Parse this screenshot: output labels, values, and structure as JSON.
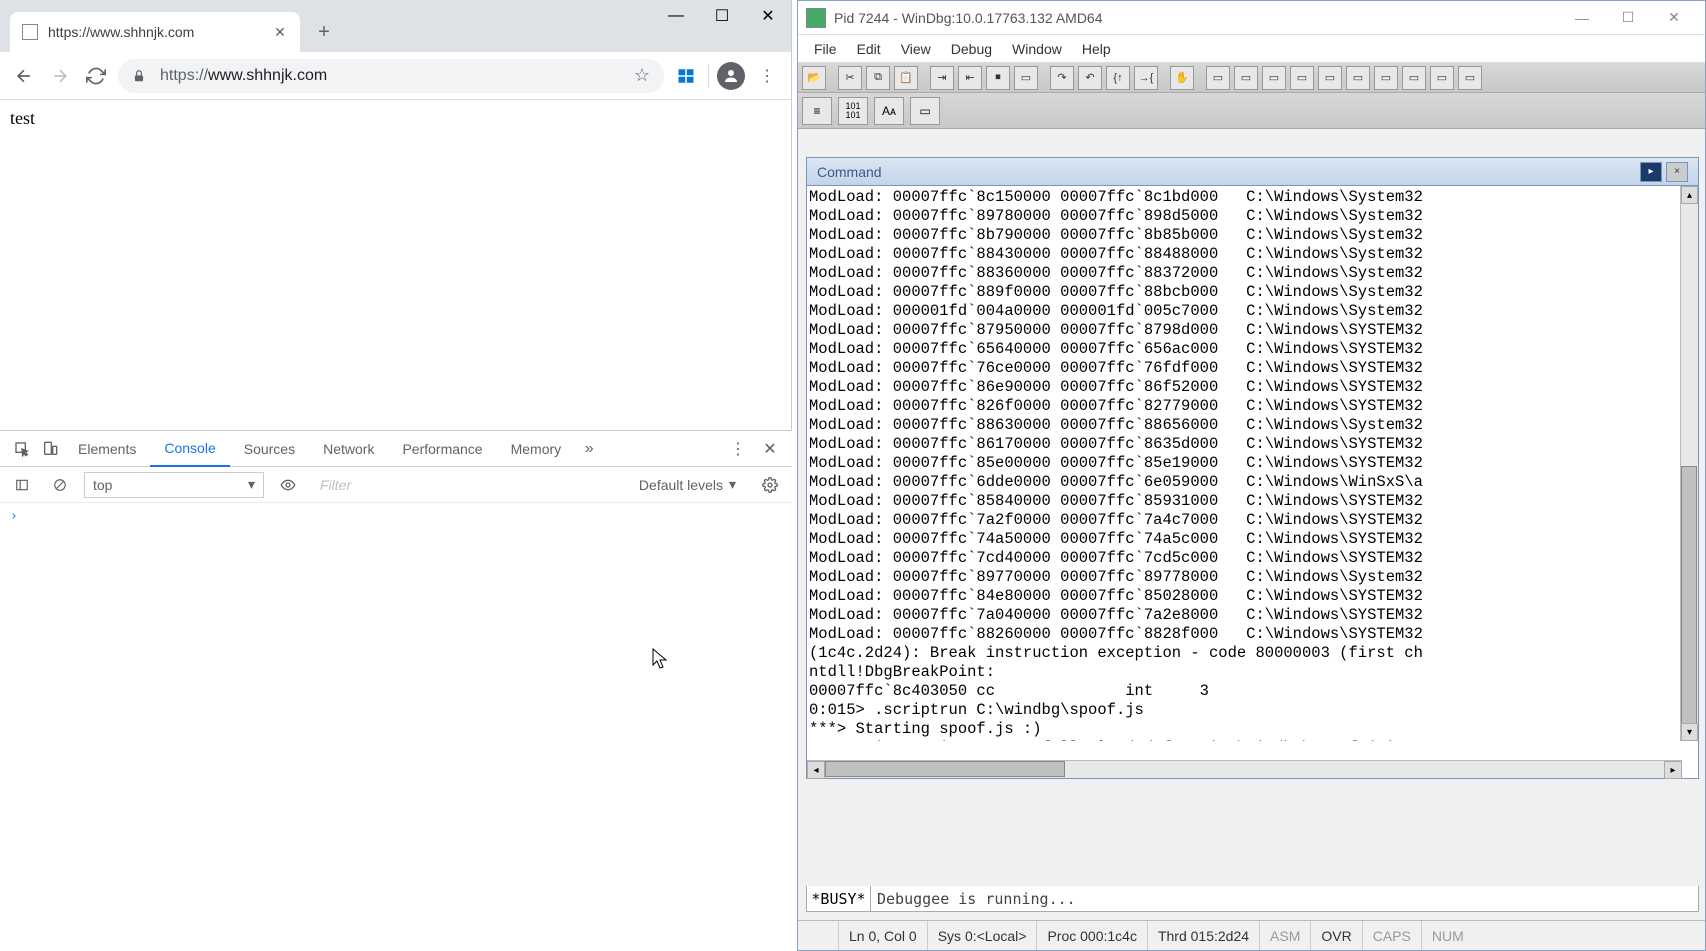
{
  "chrome": {
    "tab": {
      "title": "https://www.shhnjk.com"
    },
    "url_scheme": "https://",
    "url_rest": "www.shhnjk.com",
    "page_text": "test"
  },
  "devtools": {
    "tabs": [
      "Elements",
      "Console",
      "Sources",
      "Network",
      "Performance",
      "Memory"
    ],
    "active_tab": "Console",
    "context": "top",
    "filter_placeholder": "Filter",
    "levels": "Default levels"
  },
  "windbg": {
    "title": "Pid 7244 - WinDbg:10.0.17763.132 AMD64",
    "menus": [
      "File",
      "Edit",
      "View",
      "Debug",
      "Window",
      "Help"
    ],
    "command_title": "Command",
    "output": [
      "ModLoad: 00007ffc`8c150000 00007ffc`8c1bd000   C:\\Windows\\System32",
      "ModLoad: 00007ffc`89780000 00007ffc`898d5000   C:\\Windows\\System32",
      "ModLoad: 00007ffc`8b790000 00007ffc`8b85b000   C:\\Windows\\System32",
      "ModLoad: 00007ffc`88430000 00007ffc`88488000   C:\\Windows\\System32",
      "ModLoad: 00007ffc`88360000 00007ffc`88372000   C:\\Windows\\System32",
      "ModLoad: 00007ffc`889f0000 00007ffc`88bcb000   C:\\Windows\\System32",
      "ModLoad: 000001fd`004a0000 000001fd`005c7000   C:\\Windows\\System32",
      "ModLoad: 00007ffc`87950000 00007ffc`8798d000   C:\\Windows\\SYSTEM32",
      "ModLoad: 00007ffc`65640000 00007ffc`656ac000   C:\\Windows\\SYSTEM32",
      "ModLoad: 00007ffc`76ce0000 00007ffc`76fdf000   C:\\Windows\\SYSTEM32",
      "ModLoad: 00007ffc`86e90000 00007ffc`86f52000   C:\\Windows\\SYSTEM32",
      "ModLoad: 00007ffc`826f0000 00007ffc`82779000   C:\\Windows\\SYSTEM32",
      "ModLoad: 00007ffc`88630000 00007ffc`88656000   C:\\Windows\\System32",
      "ModLoad: 00007ffc`86170000 00007ffc`8635d000   C:\\Windows\\SYSTEM32",
      "ModLoad: 00007ffc`85e00000 00007ffc`85e19000   C:\\Windows\\SYSTEM32",
      "ModLoad: 00007ffc`6dde0000 00007ffc`6e059000   C:\\Windows\\WinSxS\\a",
      "ModLoad: 00007ffc`85840000 00007ffc`85931000   C:\\Windows\\SYSTEM32",
      "ModLoad: 00007ffc`7a2f0000 00007ffc`7a4c7000   C:\\Windows\\SYSTEM32",
      "ModLoad: 00007ffc`74a50000 00007ffc`74a5c000   C:\\Windows\\SYSTEM32",
      "ModLoad: 00007ffc`7cd40000 00007ffc`7cd5c000   C:\\Windows\\SYSTEM32",
      "ModLoad: 00007ffc`89770000 00007ffc`89778000   C:\\Windows\\System32",
      "ModLoad: 00007ffc`84e80000 00007ffc`85028000   C:\\Windows\\SYSTEM32",
      "ModLoad: 00007ffc`7a040000 00007ffc`7a2e8000   C:\\Windows\\SYSTEM32",
      "ModLoad: 00007ffc`88260000 00007ffc`8828f000   C:\\Windows\\SYSTEM32",
      "(1c4c.2d24): Break instruction exception - code 80000003 (first ch",
      "ntdll!DbgBreakPoint:",
      "00007ffc`8c403050 cc              int     3",
      "0:015> .scriptrun C:\\windbg\\spoof.js",
      "***> Starting spoof.js :)",
      "JavaScript script successfully loaded from 'C:\\windbg\\spoof.js'"
    ],
    "busy": "*BUSY*",
    "input_text": "Debuggee is running...",
    "status": {
      "ln": "Ln 0, Col 0",
      "sys": "Sys 0:<Local>",
      "proc": "Proc 000:1c4c",
      "thrd": "Thrd 015:2d24",
      "asm": "ASM",
      "ovr": "OVR",
      "caps": "CAPS",
      "num": "NUM"
    }
  }
}
